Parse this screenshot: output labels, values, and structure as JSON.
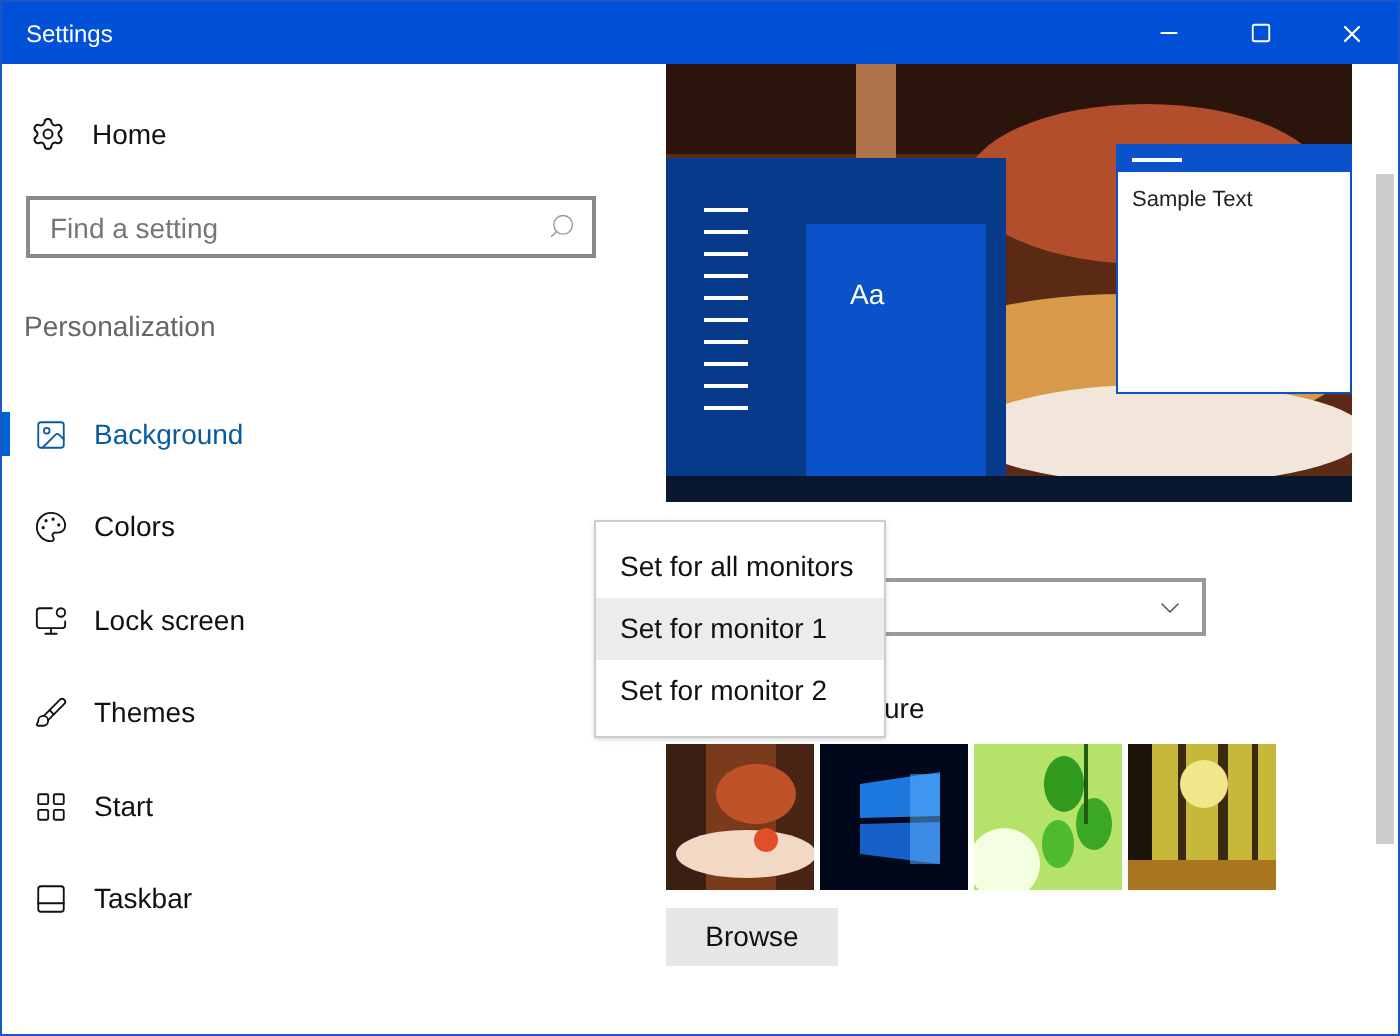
{
  "window": {
    "title": "Settings"
  },
  "sidebar": {
    "home": "Home",
    "search": {
      "placeholder": "Find a setting"
    },
    "section": "Personalization",
    "items": [
      {
        "label": "Background",
        "selected": true
      },
      {
        "label": "Colors",
        "selected": false
      },
      {
        "label": "Lock screen",
        "selected": false
      },
      {
        "label": "Themes",
        "selected": false
      },
      {
        "label": "Start",
        "selected": false
      },
      {
        "label": "Taskbar",
        "selected": false
      }
    ]
  },
  "preview": {
    "tile_text": "Aa",
    "sample_text": "Sample Text"
  },
  "picture_label": "ure",
  "thumbnails": [
    {
      "kind": "autumn"
    },
    {
      "kind": "windows"
    },
    {
      "kind": "leaves"
    },
    {
      "kind": "forest"
    }
  ],
  "browse": "Browse",
  "menu": [
    {
      "label": "Set for all monitors",
      "selected": false
    },
    {
      "label": "Set for monitor 1",
      "selected": true
    },
    {
      "label": "Set for monitor 2",
      "selected": false
    }
  ]
}
